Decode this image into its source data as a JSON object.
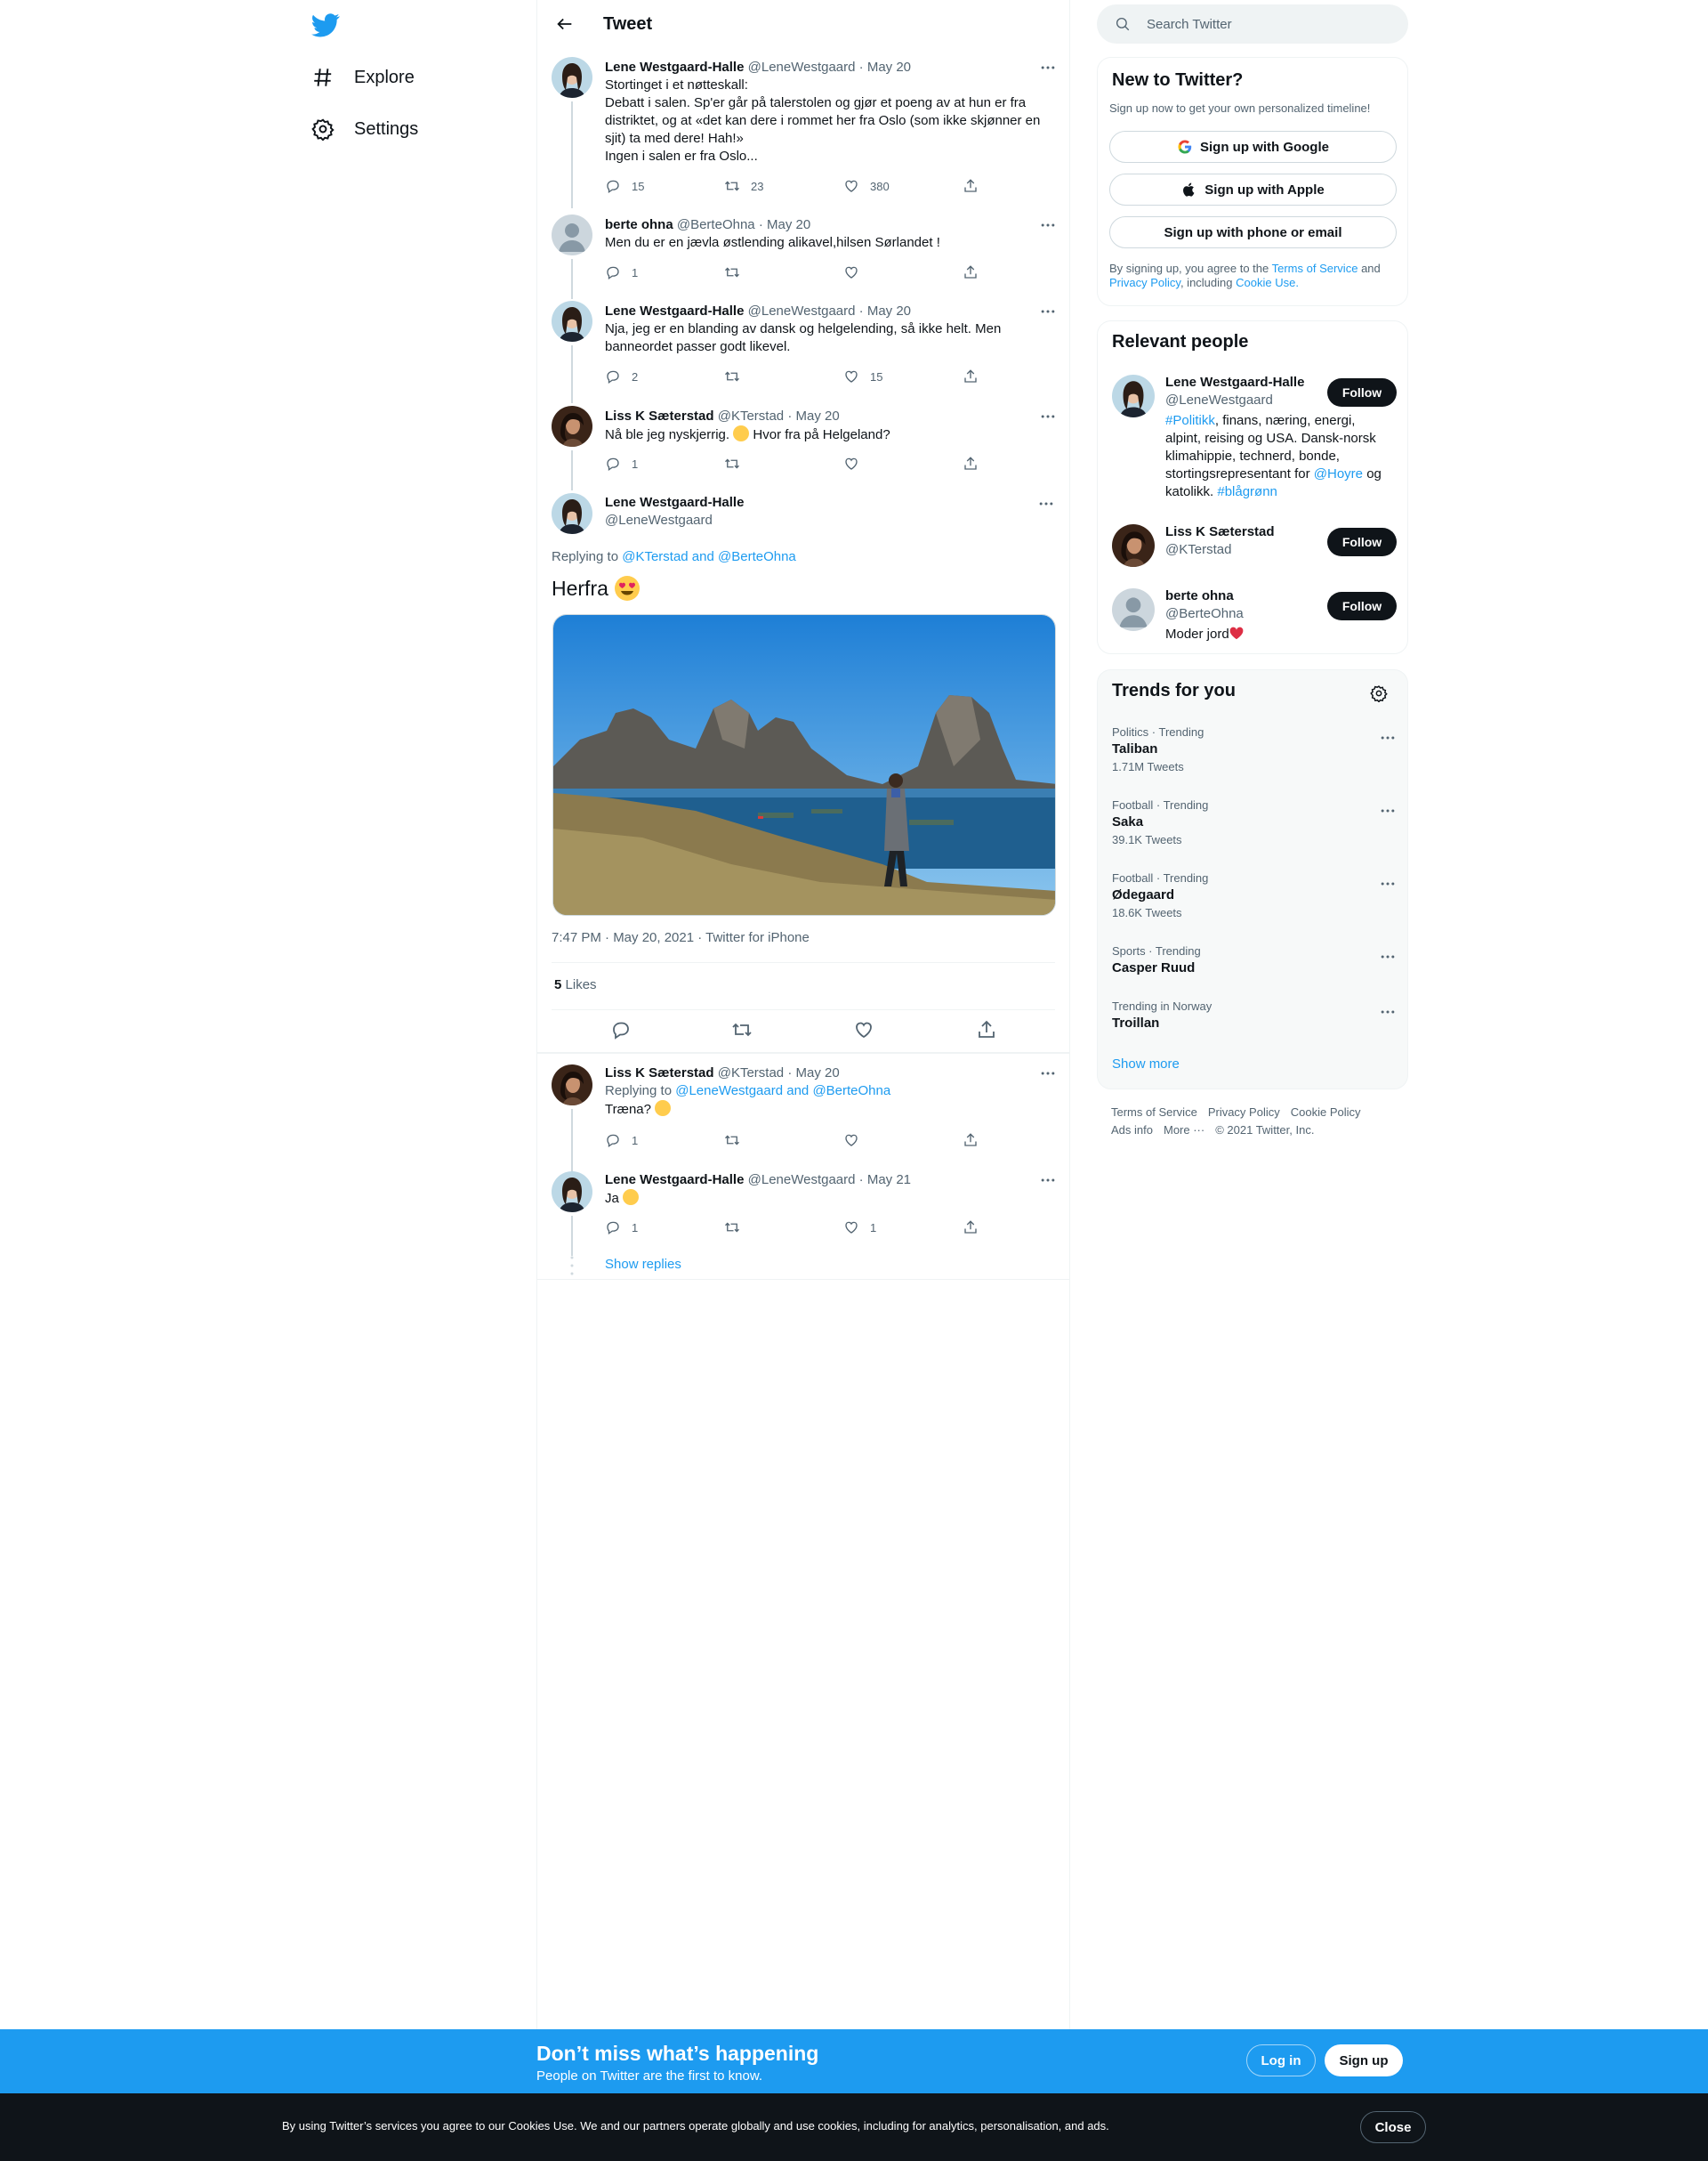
{
  "nav": {
    "items": [
      {
        "label": "Explore",
        "icon": "hashtag-icon"
      },
      {
        "label": "Settings",
        "icon": "gear-icon"
      }
    ]
  },
  "header": {
    "title": "Tweet"
  },
  "thread": [
    {
      "name": "Lene Westgaard-Halle",
      "handle": "@LeneWestgaard",
      "date": "May 20",
      "lines": [
        "Stortinget i et nøtteskall:",
        "Debatt i salen. Sp'er går på talerstolen og gjør et poeng av at hun er fra",
        "distriktet, og at «det kan dere i rommet her fra Oslo (som ikke skjønner en",
        "sjit) ta med dere! Hah!»",
        "Ingen i salen er fra Oslo..."
      ],
      "replies": "15",
      "retweets": "23",
      "likes": "380"
    },
    {
      "name": "berte ohna",
      "handle": "@BerteOhna",
      "date": "May 20",
      "lines": [
        "Men du er en jævla østlending alikavel,hilsen Sørlandet !"
      ],
      "replies": "1",
      "retweets": "",
      "likes": ""
    },
    {
      "name": "Lene Westgaard-Halle",
      "handle": "@LeneWestgaard",
      "date": "May 20",
      "lines": [
        "Nja, jeg er en blanding av dansk og helgelending, så ikke helt. Men",
        "banneordet passer godt likevel."
      ],
      "replies": "2",
      "retweets": "",
      "likes": "15"
    },
    {
      "name": "Liss K Sæterstad",
      "handle": "@KTerstad",
      "date": "May 20",
      "text_before_emoji": "Nå ble jeg nyskjerrig.",
      "text_after_emoji": "Hvor fra på Helgeland?",
      "replies": "1",
      "retweets": "",
      "likes": ""
    }
  ],
  "focused": {
    "name": "Lene Westgaard-Halle",
    "handle": "@LeneWestgaard",
    "replying_prefix": "Replying to",
    "replying_to": "@KTerstad and @BerteOhna",
    "text": "Herfra",
    "meta": "7:47 PM · May 20, 2021 · Twitter for iPhone",
    "likes_count": "5",
    "likes_label": "Likes"
  },
  "replies": [
    {
      "name": "Liss K Sæterstad",
      "handle": "@KTerstad",
      "date": "May 20",
      "replying_prefix": "Replying to",
      "replying_to": "@LeneWestgaard and @BerteOhna",
      "text": "Træna?",
      "replies": "1",
      "retweets": "",
      "likes": ""
    },
    {
      "name": "Lene Westgaard-Halle",
      "handle": "@LeneWestgaard",
      "date": "May 21",
      "text": "Ja",
      "replies": "1",
      "retweets": "",
      "likes": "1"
    }
  ],
  "show_replies": "Show replies",
  "search": {
    "placeholder": "Search Twitter"
  },
  "new_to_twitter": {
    "title": "New to Twitter?",
    "subtitle": "Sign up now to get your own personalized timeline!",
    "google": "Sign up with Google",
    "apple": "Sign up with Apple",
    "phone": "Sign up with phone or email",
    "terms_a": "By signing up, you agree to the",
    "terms_link1": "Terms of Service",
    "terms_b": "and",
    "terms_link2": "Privacy Policy",
    "terms_c": ", including",
    "terms_link3": "Cookie Use."
  },
  "relevant": {
    "title": "Relevant people",
    "follow_label": "Follow",
    "people": [
      {
        "name": "Lene Westgaard-Halle",
        "handle": "@LeneWestgaard",
        "bio_tag1": "#Politikk",
        "bio_a": ", finans, næring, energi, alpint, reising og USA. Dansk-norsk klimahippie, technerd, bonde, stortingsrepresentant for",
        "bio_mention": "@Hoyre",
        "bio_b": "og katolikk.",
        "bio_tag2": "#blågrønn"
      },
      {
        "name": "Liss K Sæterstad",
        "handle": "@KTerstad"
      },
      {
        "name": "berte ohna",
        "handle": "@BerteOhna",
        "bio": "Moder jord"
      }
    ]
  },
  "trends": {
    "title": "Trends for you",
    "items": [
      {
        "context": "Politics · Trending",
        "name": "Taliban",
        "count": "1.71M Tweets"
      },
      {
        "context": "Football · Trending",
        "name": "Saka",
        "count": "39.1K Tweets"
      },
      {
        "context": "Football · Trending",
        "name": "Ødegaard",
        "count": "18.6K Tweets"
      },
      {
        "context": "Sports · Trending",
        "name": "Casper Ruud",
        "count": ""
      },
      {
        "context": "Trending in Norway",
        "name": "Troillan",
        "count": ""
      }
    ],
    "show_more": "Show more"
  },
  "footer": {
    "links": [
      "Terms of Service",
      "Privacy Policy",
      "Cookie Policy",
      "Ads info",
      "More ···",
      "© 2021 Twitter, Inc."
    ]
  },
  "banner": {
    "title": "Don’t miss what’s happening",
    "subtitle": "People on Twitter are the first to know.",
    "login": "Log in",
    "signup": "Sign up"
  },
  "cookie": {
    "text": "By using Twitter’s services you agree to our Cookies Use. We and our partners operate globally and use cookies, including for analytics, personalisation, and ads.",
    "close": "Close"
  },
  "colors": {
    "accent": "#1d9bf0",
    "text": "#0f1419",
    "muted": "#536471",
    "like": "#f91880"
  }
}
